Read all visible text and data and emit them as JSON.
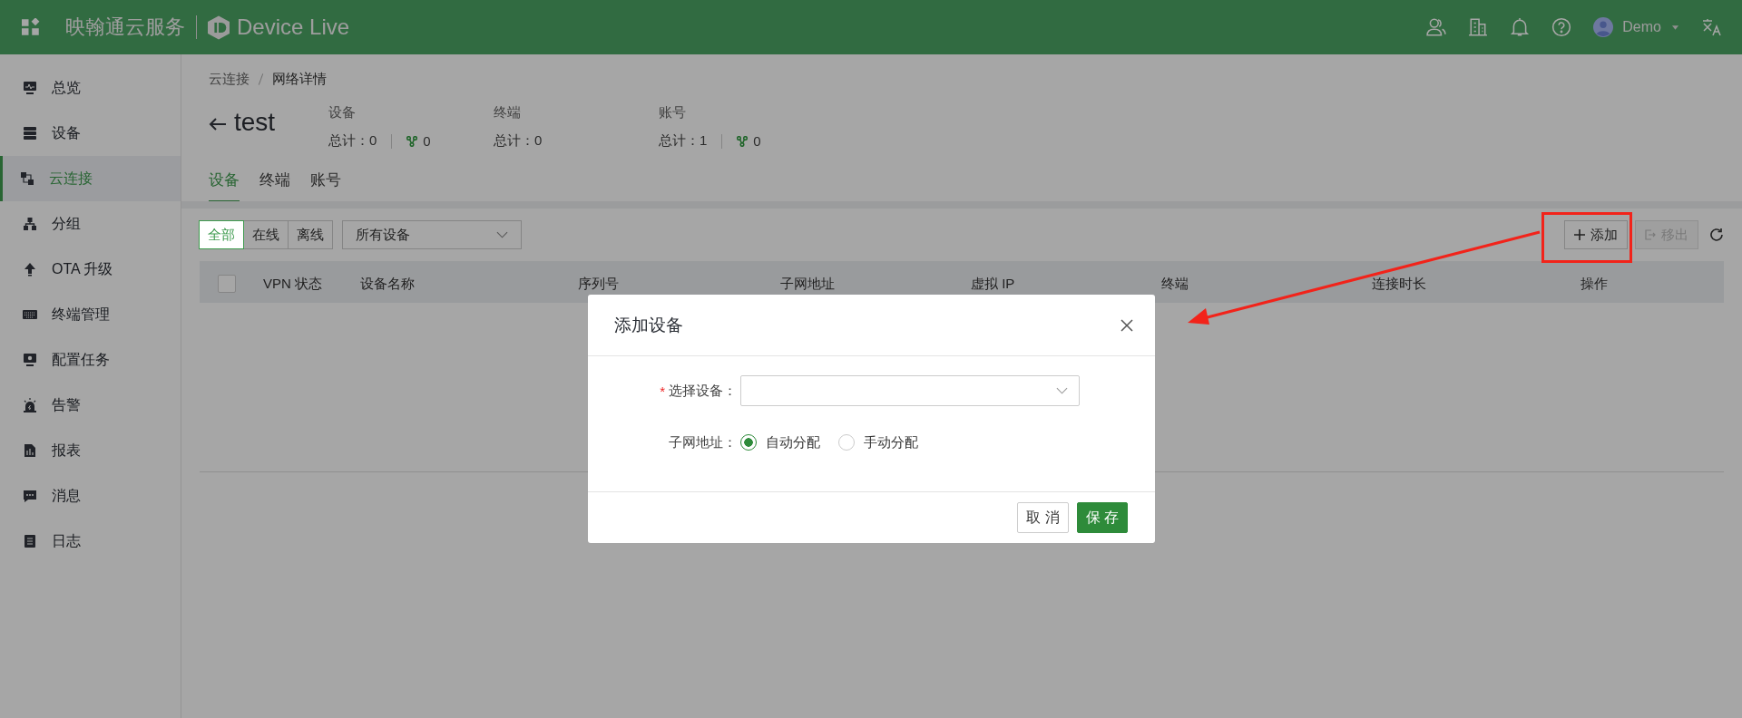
{
  "app": {
    "brand": "映翰通云服务",
    "product": "Device Live"
  },
  "header": {
    "user": "Demo"
  },
  "sidebar": {
    "items": [
      {
        "label": "总览",
        "selected": false
      },
      {
        "label": "设备",
        "selected": false
      },
      {
        "label": "云连接",
        "selected": true
      },
      {
        "label": "分组",
        "selected": false
      },
      {
        "label": "OTA 升级",
        "selected": false
      },
      {
        "label": "终端管理",
        "selected": false
      },
      {
        "label": "配置任务",
        "selected": false
      },
      {
        "label": "告警",
        "selected": false
      },
      {
        "label": "报表",
        "selected": false
      },
      {
        "label": "消息",
        "selected": false
      },
      {
        "label": "日志",
        "selected": false
      }
    ]
  },
  "breadcrumb": [
    "云连接",
    "网络详情"
  ],
  "title": "test",
  "stats": [
    {
      "label": "设备",
      "total": "总计：0",
      "online": "0"
    },
    {
      "label": "终端",
      "total": "总计：0"
    },
    {
      "label": "账号",
      "total": "总计：1",
      "online": "0"
    }
  ],
  "tabs": [
    {
      "label": "设备",
      "selected": true
    },
    {
      "label": "终端",
      "selected": false
    },
    {
      "label": "账号",
      "selected": false
    }
  ],
  "filters": [
    {
      "label": "全部",
      "selected": true
    },
    {
      "label": "在线",
      "selected": false
    },
    {
      "label": "离线",
      "selected": false
    }
  ],
  "device_select": {
    "value": "所有设备"
  },
  "actions": [
    {
      "label": "添加",
      "kind": "add",
      "disabled": false
    },
    {
      "label": "移出",
      "kind": "remove",
      "disabled": true
    }
  ],
  "table": {
    "select_all_checked": false,
    "columns": [
      "VPN 状态",
      "设备名称",
      "序列号",
      "子网地址",
      "虚拟 IP",
      "终端",
      "连接时长",
      "操作"
    ]
  },
  "dialog": {
    "title": "添加设备",
    "fields": [
      {
        "kind": "select",
        "label": "选择设备：",
        "mark": "*"
      },
      {
        "kind": "radio",
        "label": "子网地址：",
        "options": [
          {
            "label": "自动分配",
            "selected": true
          },
          {
            "label": "手动分配",
            "selected": false
          }
        ]
      }
    ],
    "buttons": [
      {
        "label": "取 消",
        "kind": "secondary"
      },
      {
        "label": "保 存",
        "kind": "primary"
      }
    ]
  }
}
